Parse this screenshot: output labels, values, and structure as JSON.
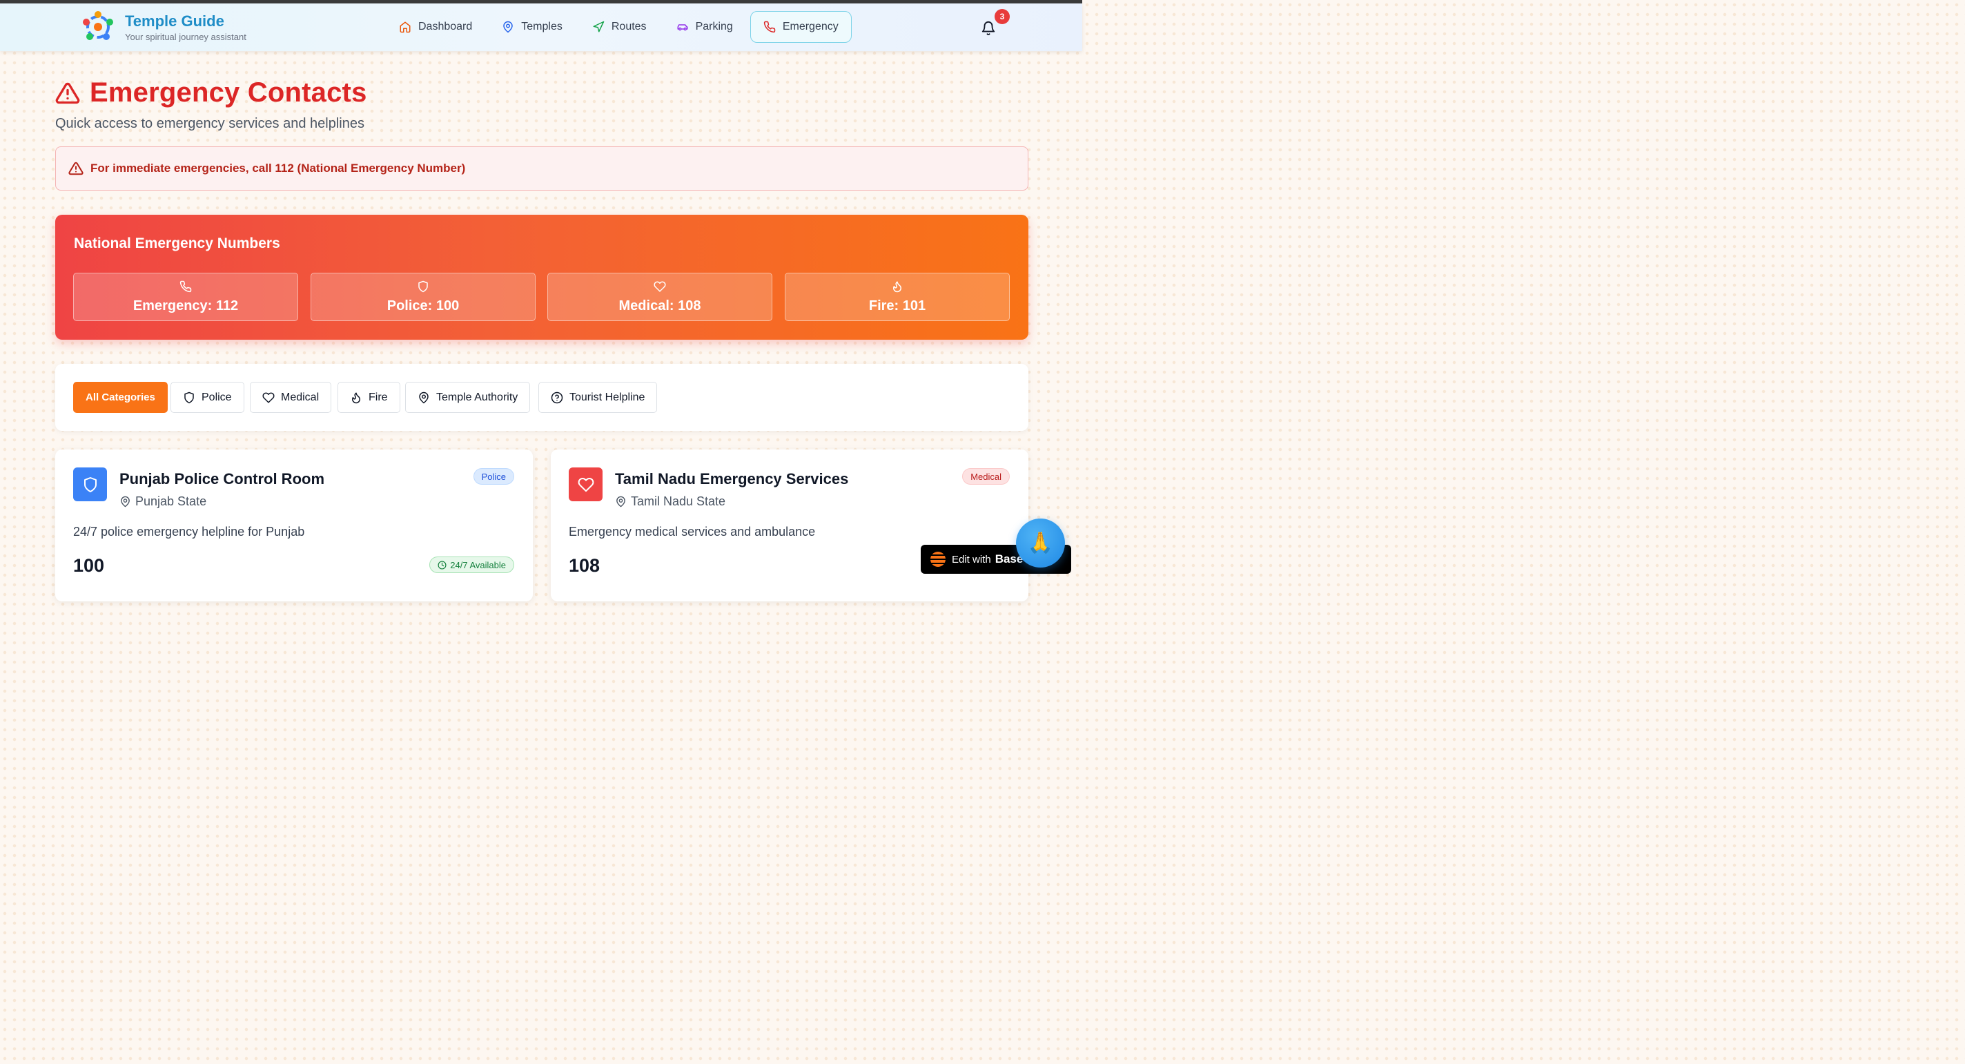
{
  "brand": {
    "title": "Temple Guide",
    "subtitle": "Your spiritual journey assistant"
  },
  "nav": {
    "items": [
      {
        "label": "Dashboard",
        "icon": "home-icon",
        "color": "#ea580c"
      },
      {
        "label": "Temples",
        "icon": "map-pin-icon",
        "color": "#2563eb"
      },
      {
        "label": "Routes",
        "icon": "navigation-icon",
        "color": "#16a34a"
      },
      {
        "label": "Parking",
        "icon": "car-icon",
        "color": "#9333ea"
      },
      {
        "label": "Emergency",
        "icon": "phone-icon",
        "color": "#dc2626",
        "active": true
      }
    ],
    "notifications_count": "3"
  },
  "page": {
    "title": "Emergency Contacts",
    "subtitle": "Quick access to emergency services and helplines",
    "alert": "For immediate emergencies, call 112 (National Emergency Number)"
  },
  "national": {
    "title": "National Emergency Numbers",
    "items": [
      {
        "label": "Emergency: 112",
        "icon": "phone-icon"
      },
      {
        "label": "Police: 100",
        "icon": "shield-icon"
      },
      {
        "label": "Medical: 108",
        "icon": "heart-icon"
      },
      {
        "label": "Fire: 101",
        "icon": "flame-icon"
      }
    ]
  },
  "filters": [
    {
      "label": "All Categories",
      "active": true
    },
    {
      "label": "Police",
      "icon": "shield-icon"
    },
    {
      "label": "Medical",
      "icon": "heart-icon"
    },
    {
      "label": "Fire",
      "icon": "flame-icon"
    },
    {
      "label": "Temple Authority",
      "icon": "map-pin-icon"
    },
    {
      "label": "Tourist Helpline",
      "icon": "help-circle-icon"
    }
  ],
  "contacts": [
    {
      "name": "Punjab Police Control Room",
      "location": "Punjab State",
      "tag": "Police",
      "description": "24/7 police emergency helpline for Punjab",
      "number": "100",
      "availability": "24/7 Available",
      "accent": "#3b82f6"
    },
    {
      "name": "Tamil Nadu Emergency Services",
      "location": "Tamil Nadu State",
      "tag": "Medical",
      "description": "Emergency medical services and ambulance",
      "number": "108",
      "accent": "#ef4444"
    }
  ],
  "edit_badge": {
    "prefix": "Edit with",
    "brand": "Base"
  },
  "fab_icon": "🙏"
}
